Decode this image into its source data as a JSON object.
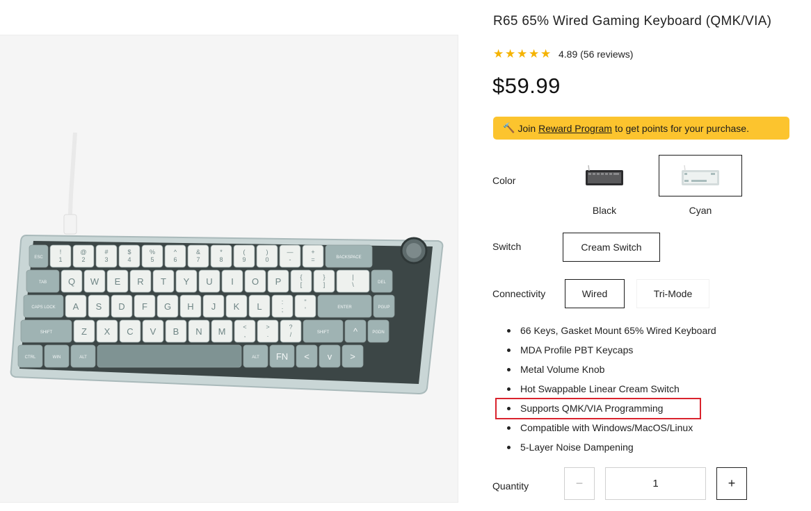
{
  "product": {
    "title": "R65 65% Wired Gaming Keyboard (QMK/VIA)",
    "rating_text": "4.89 (56 reviews)",
    "rating_value": 4.89,
    "stars_filled": 5,
    "star_color": "#f5b301",
    "price": "$59.99"
  },
  "reward": {
    "icon": "hammer-icon",
    "prefix": "Join",
    "link": "Reward Program",
    "suffix": "to get points for your purchase.",
    "bg_color": "#fcc42e"
  },
  "options": {
    "color": {
      "label": "Color",
      "choices": [
        {
          "name": "Black",
          "selected": false
        },
        {
          "name": "Cyan",
          "selected": true
        }
      ]
    },
    "switch": {
      "label": "Switch",
      "choices": [
        {
          "name": "Cream Switch",
          "selected": true
        }
      ]
    },
    "connectivity": {
      "label": "Connectivity",
      "choices": [
        {
          "name": "Wired",
          "selected": true
        },
        {
          "name": "Tri-Mode",
          "selected": false
        }
      ]
    }
  },
  "features": [
    "66 Keys, Gasket Mount 65% Wired Keyboard",
    "MDA Profile PBT Keycaps",
    "Metal Volume Knob",
    "Hot Swappable Linear Cream Switch",
    "Supports QMK/VIA Programming",
    "Compatible with Windows/MacOS/Linux",
    "5-Layer Noise Dampening"
  ],
  "highlighted_feature_index": 4,
  "highlight_color": "#d9232d",
  "quantity": {
    "label": "Quantity",
    "value": "1",
    "minus": "−",
    "plus": "+"
  },
  "keyboard_legends": {
    "row1": [
      "ESC",
      "!\n1",
      "@\n2",
      "#\n3",
      "$\n4",
      "%\n5",
      "^\n6",
      "&\n7",
      "*\n8",
      "(\n9",
      ")\n0",
      "—\n-",
      "+\n=",
      "BACKSPACE"
    ],
    "row2": [
      "TAB",
      "Q",
      "W",
      "E",
      "R",
      "T",
      "Y",
      "U",
      "I",
      "O",
      "P",
      "{\n[",
      "}\n]",
      "|\n\\",
      "DEL"
    ],
    "row3": [
      "CAPS LOCK",
      "A",
      "S",
      "D",
      "F",
      "G",
      "H",
      "J",
      "K",
      "L",
      ":\n;",
      "\"\n'",
      "ENTER",
      "PGUP"
    ],
    "row4": [
      "SHIFT",
      "Z",
      "X",
      "C",
      "V",
      "B",
      "N",
      "M",
      "<\n,",
      ">\n.",
      "?\n/",
      "SHIFT",
      "^",
      "PGDN"
    ],
    "row5": [
      "CTRL",
      "WIN",
      "ALT",
      "",
      "ALT",
      "FN",
      "<",
      "v",
      ">"
    ]
  }
}
